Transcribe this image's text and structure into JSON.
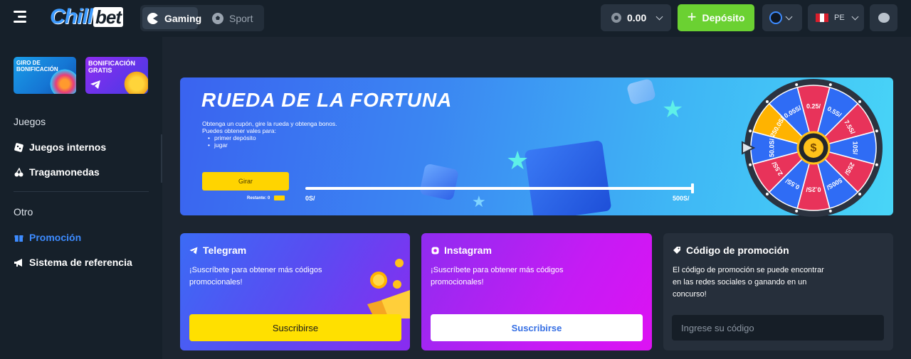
{
  "topbar": {
    "logo_part1": "Chill",
    "logo_part2": "bet",
    "modes": [
      {
        "label": "Gaming",
        "active": true
      },
      {
        "label": "Sport",
        "active": false
      }
    ],
    "balance": "0.00",
    "deposit_label": "Depósito",
    "language": "PE"
  },
  "sidebar": {
    "promo_cards": [
      {
        "label": "GIRO DE BONIFICACIÓN"
      },
      {
        "label": "BONIFICACIÓN GRATIS"
      }
    ],
    "section_games": "Juegos",
    "games_items": [
      {
        "label": "Juegos internos",
        "icon": "dice-icon"
      },
      {
        "label": "Tragamonedas",
        "icon": "cherries-icon"
      }
    ],
    "section_other": "Otro",
    "other_items": [
      {
        "label": "Promoción",
        "icon": "gift-icon",
        "active": true
      },
      {
        "label": "Sistema de referencia",
        "icon": "megaphone-icon"
      }
    ]
  },
  "banner": {
    "title": "RUEDA DE LA FORTUNA",
    "desc_line1": "Obtenga un cupón, gire la rueda y obtenga bonos.",
    "desc_line2": "Puedes obtener vales para:",
    "bullets": [
      "primer depósito",
      "jugar"
    ],
    "spin_label": "Girar",
    "remaining_label": "Restante: 0",
    "progress_min": "0S/",
    "progress_max": "500S/",
    "progress_fraction": 1.0,
    "wheel_segments": [
      "0.25/",
      "0.5S/",
      "7.5S/",
      "10S/",
      "25S/",
      "500S/",
      "0.2S/",
      "0.5S/",
      "2.5S/",
      "50.0S/",
      "250.0S/",
      "0.05S/"
    ],
    "colors": {
      "accent_yellow": "#ffd400",
      "wheel_red": "#e8335a",
      "wheel_blue": "#2f6cf5"
    }
  },
  "cards": {
    "telegram": {
      "title": "Telegram",
      "text": "¡Suscríbete para obtener más códigos promocionales!",
      "button": "Suscribirse"
    },
    "instagram": {
      "title": "Instagram",
      "text": "¡Suscríbete para obtener más códigos promocionales!",
      "button": "Suscribirse"
    },
    "promo_code": {
      "title": "Código de promoción",
      "text": "El código de promoción se puede encontrar en las redes sociales o ganando en un concurso!",
      "placeholder": "Ingrese su código"
    }
  },
  "colors": {
    "deposit_green": "#6bd132",
    "active_blue": "#3d8bff",
    "sidebar_bg": "#16202a",
    "page_bg": "#1c2530"
  }
}
